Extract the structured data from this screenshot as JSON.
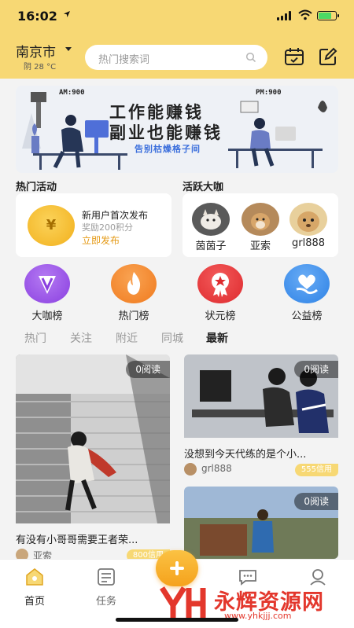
{
  "status_bar": {
    "time": "16:02",
    "battery_level": 0.8
  },
  "header": {
    "city": "南京市",
    "weather": "阴 28 °C",
    "search_placeholder": "热门搜索词",
    "icons": [
      "calendar-icon",
      "edit-icon"
    ]
  },
  "banner": {
    "am_label": "AM:900",
    "pm_label": "PM:900",
    "line1": "工作能赚钱",
    "line2": "副业也能赚钱",
    "line3": "告别枯燥格子间"
  },
  "hot_activity": {
    "title": "热门活动",
    "card_title": "新用户首次发布",
    "card_sub": "奖励200积分",
    "card_link": "立即发布",
    "coin_symbol": "¥"
  },
  "active_experts": {
    "title": "活跃大咖",
    "users": [
      {
        "name": "茵茵子"
      },
      {
        "name": "亚索"
      },
      {
        "name": "grl888"
      }
    ]
  },
  "rankings": [
    {
      "label": "大咖榜",
      "icon": "v-icon",
      "color": "#9a4ee6"
    },
    {
      "label": "热门榜",
      "icon": "flame-icon",
      "color": "#f28a2c"
    },
    {
      "label": "状元榜",
      "icon": "medal-icon",
      "color": "#e8383a"
    },
    {
      "label": "公益榜",
      "icon": "heart-hand-icon",
      "color": "#3a8ee8"
    }
  ],
  "tabs": [
    {
      "label": "热门",
      "active": false
    },
    {
      "label": "关注",
      "active": false
    },
    {
      "label": "附近",
      "active": false
    },
    {
      "label": "同城",
      "active": false
    },
    {
      "label": "最新",
      "active": true
    }
  ],
  "posts": [
    {
      "reads": "0阅读",
      "title": "有没有小哥哥需要王者荣...",
      "author": "亚索",
      "badge": "800信用"
    },
    {
      "reads": "0阅读",
      "title": "没想到今天代练的是个小...",
      "author": "grl888",
      "badge": "555信用"
    },
    {
      "reads": "0阅读",
      "title": "",
      "author": "",
      "badge": ""
    }
  ],
  "bottom_nav": [
    {
      "label": "首页",
      "icon": "home-icon",
      "active": true
    },
    {
      "label": "任务",
      "icon": "task-icon",
      "active": false
    },
    {
      "label": "",
      "icon": "message-icon",
      "active": false
    },
    {
      "label": "",
      "icon": "profile-icon",
      "active": false
    }
  ],
  "watermark": {
    "brand": "永辉资源网",
    "url": "www.yhkjjj.com"
  },
  "colors": {
    "header_yellow": "#f7d874",
    "accent_orange": "#f5a21c",
    "link_orange": "#e59a16",
    "banner_blue": "#3a6edc"
  }
}
